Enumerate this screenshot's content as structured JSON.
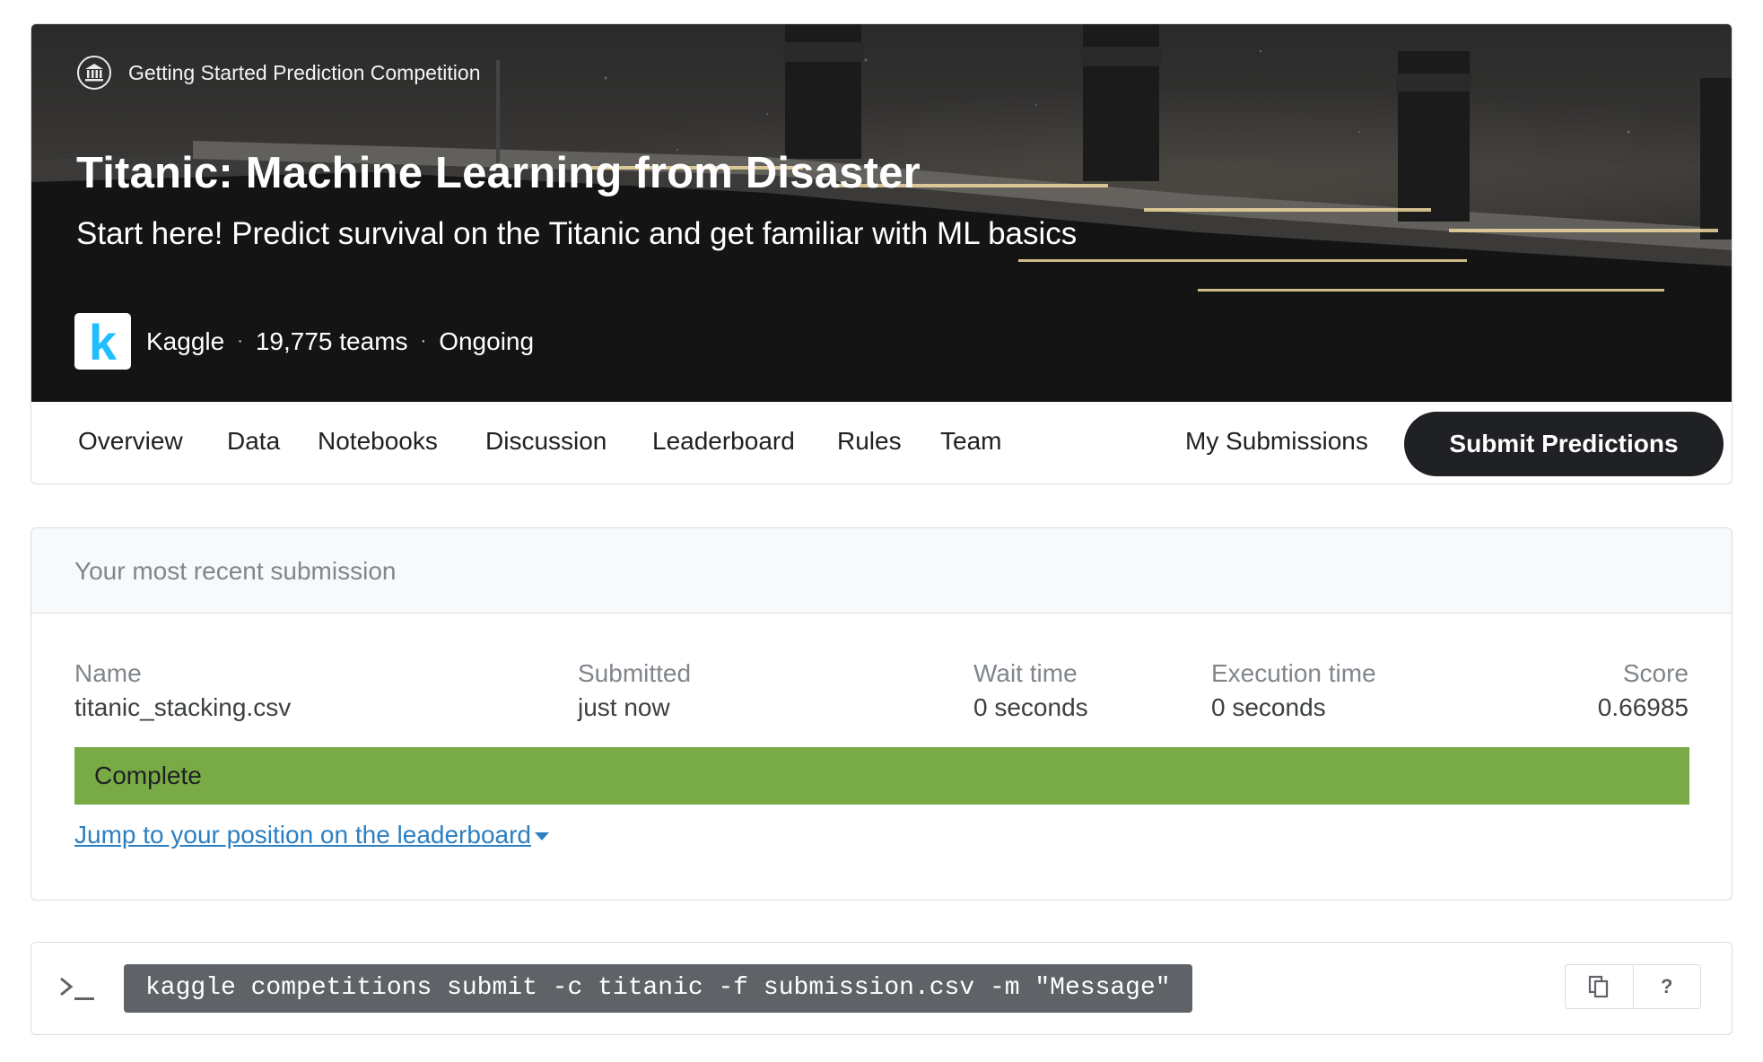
{
  "competition": {
    "type_label": "Getting Started Prediction Competition",
    "title": "Titanic: Machine Learning from Disaster",
    "subtitle": "Start here! Predict survival on the Titanic and get familiar with ML basics",
    "host_logo_letter": "k",
    "host": "Kaggle",
    "teams": "19,775 teams",
    "status": "Ongoing",
    "separator": "·"
  },
  "nav": {
    "items": [
      "Overview",
      "Data",
      "Notebooks",
      "Discussion",
      "Leaderboard",
      "Rules",
      "Team"
    ],
    "my_submissions": "My Submissions",
    "submit_predictions": "Submit Predictions"
  },
  "submission": {
    "header": "Your most recent submission",
    "columns": {
      "name": {
        "label": "Name",
        "value": "titanic_stacking.csv"
      },
      "submitted": {
        "label": "Submitted",
        "value": "just now"
      },
      "wait_time": {
        "label": "Wait time",
        "value": "0 seconds"
      },
      "execution_time": {
        "label": "Execution time",
        "value": "0 seconds"
      },
      "score": {
        "label": "Score",
        "value": "0.66985"
      }
    },
    "status": "Complete",
    "status_color": "#78ab46",
    "jump_link": "Jump to your position on the leaderboard"
  },
  "cli": {
    "command": "kaggle competitions submit -c titanic -f submission.csv -m \"Message\"",
    "copy_icon": "copy-icon",
    "help_label": "?"
  },
  "colors": {
    "primary_button": "#202124",
    "link": "#2c7fc1",
    "logo_accent": "#20beff"
  }
}
